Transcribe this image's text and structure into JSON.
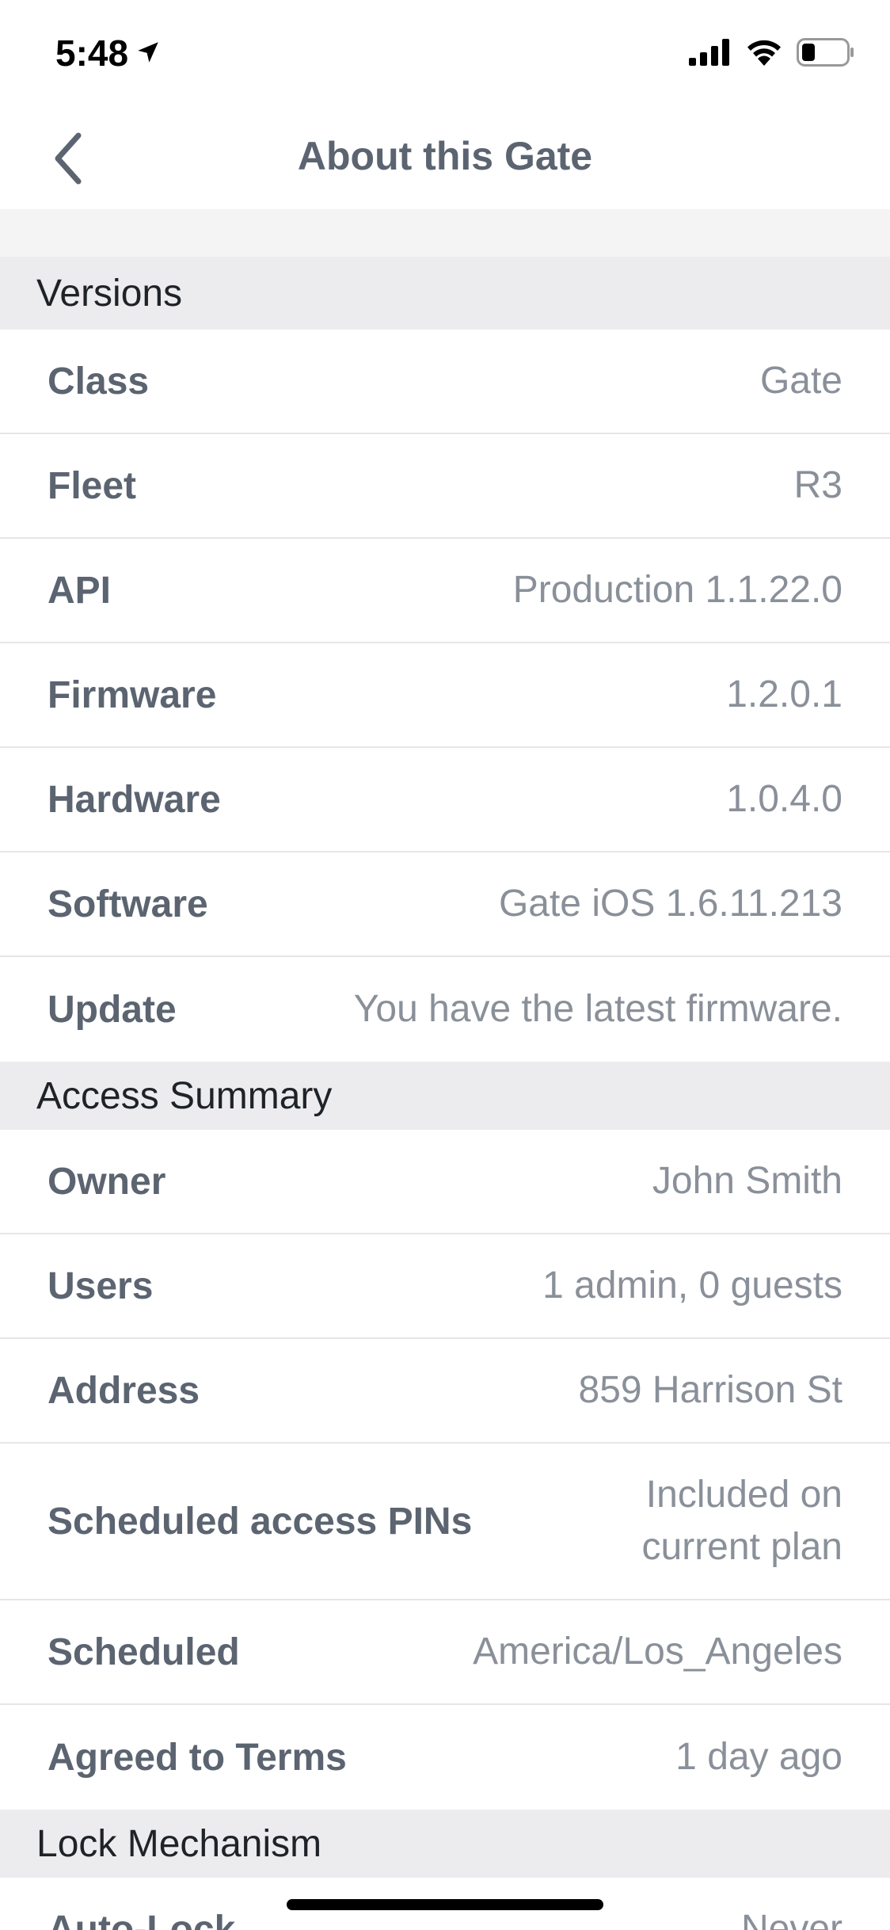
{
  "status_bar": {
    "time": "5:48",
    "icons": [
      "location-arrow-icon",
      "cellular-signal-icon",
      "wifi-icon",
      "battery-icon"
    ]
  },
  "nav": {
    "title": "About this Gate",
    "back_icon": "chevron-left-icon"
  },
  "sections": {
    "versions": {
      "title": "Versions",
      "rows": [
        {
          "label": "Class",
          "value": "Gate"
        },
        {
          "label": "Fleet",
          "value": "R3"
        },
        {
          "label": "API",
          "value": "Production 1.1.22.0"
        },
        {
          "label": "Firmware",
          "value": "1.2.0.1"
        },
        {
          "label": "Hardware",
          "value": "1.0.4.0"
        },
        {
          "label": "Software",
          "value": "Gate iOS 1.6.11.213"
        },
        {
          "label": "Update",
          "value": "You have the latest firmware."
        }
      ]
    },
    "access_summary": {
      "title": "Access Summary",
      "rows": [
        {
          "label": "Owner",
          "value": "John Smith"
        },
        {
          "label": "Users",
          "value": "1 admin, 0 guests"
        },
        {
          "label": "Address",
          "value": "859 Harrison St"
        },
        {
          "label": "Scheduled access PINs",
          "value": "Included on current plan"
        },
        {
          "label": "Scheduled",
          "value": "America/Los_Angeles"
        },
        {
          "label": "Agreed to Terms",
          "value": "1 day ago"
        }
      ]
    },
    "lock_mechanism": {
      "title": "Lock Mechanism",
      "rows": [
        {
          "label": "Auto-Lock",
          "value": "Never"
        }
      ]
    }
  },
  "colors": {
    "label": "#5b6470",
    "value": "#8a9099",
    "section_bg": "#ececee"
  }
}
